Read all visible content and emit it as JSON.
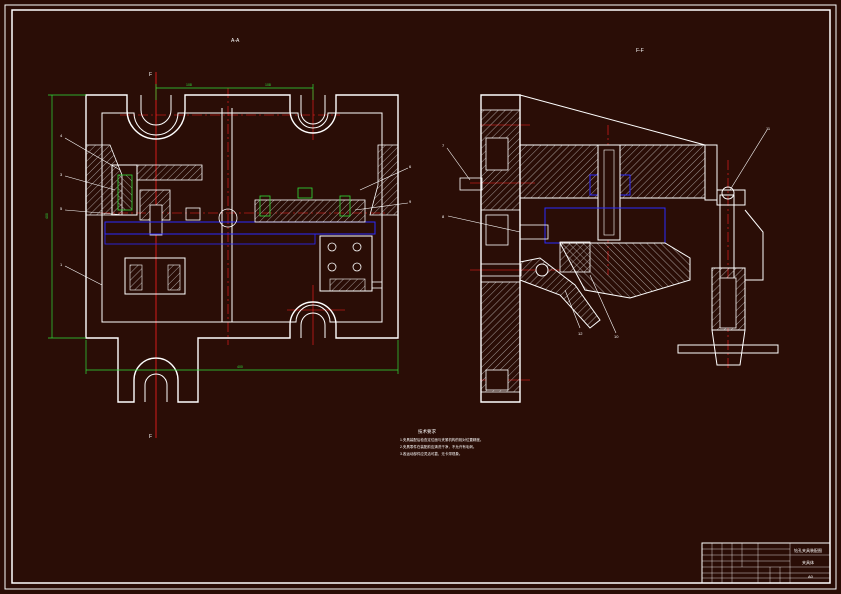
{
  "drawing": {
    "colors": {
      "background": "#2a0d06",
      "outline": "#ffffff",
      "centerline": "#ff2020",
      "dimension": "#2fe03a",
      "hidden": "#2a2aff",
      "hatch": "#d8d8d8"
    },
    "view_left": {
      "title": "A-A",
      "section_mark_top": "F",
      "section_mark_bottom": "F",
      "dims": {
        "top_left": "108",
        "top_right": "108",
        "height": "400",
        "width": "400"
      }
    },
    "view_right": {
      "title": "F-F"
    },
    "balloons": {
      "left": [
        "4",
        "3",
        "5",
        "1",
        "6",
        "9"
      ],
      "right": [
        "7",
        "8",
        "11",
        "12",
        "10"
      ]
    },
    "notes": {
      "title": "技术要求",
      "lines": [
        "1.夹具装配后检查定位面与夹紧机构的相对位置精度。",
        "2.夹具零件在装配前应清洗干净，不允许有毛刺。",
        "3.各运动部件应灵活可靠，无卡滞现象。"
      ]
    },
    "title_block": {
      "drawing_name": "钻孔夹具装配图",
      "sub_name": "夹具体",
      "sheet": "A0"
    }
  }
}
